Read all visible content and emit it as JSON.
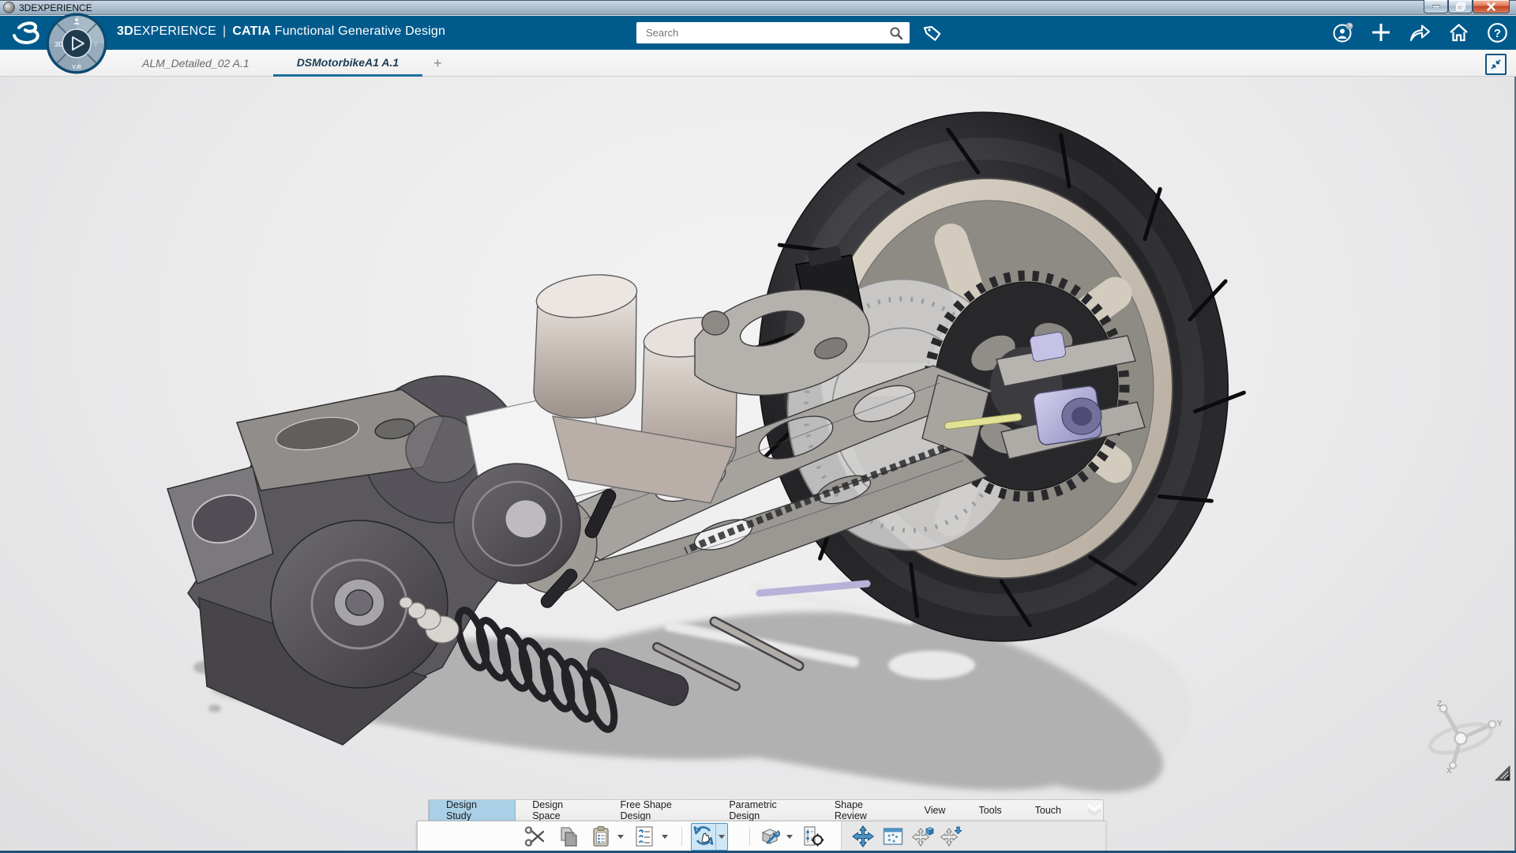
{
  "window": {
    "title": "3DEXPERIENCE",
    "controls": [
      "minimize",
      "restore",
      "close"
    ]
  },
  "appbar": {
    "brand_bold": "3D",
    "brand_rest": "EXPERIENCE",
    "divider": "|",
    "app_name": "CATIA",
    "app_role": "Functional Generative Design",
    "search_placeholder": "Search",
    "right_icons": [
      "user-profile",
      "add-content",
      "share",
      "home",
      "help"
    ],
    "compass": {
      "left": "3D",
      "right": "i",
      "bottom": "V.R",
      "top_icon": "user-quadrant-icon",
      "center_icon": "play-icon"
    }
  },
  "document_tabs": {
    "items": [
      {
        "label": "ALM_Detailed_02 A.1",
        "active": false
      },
      {
        "label": "DSMotorbikeA1 A.1",
        "active": true
      }
    ],
    "new_tab_label": "+"
  },
  "viewport": {
    "model": "motorbike rear assembly 3D model",
    "axis_triad": {
      "x": "X",
      "y": "Y",
      "z": "Z"
    }
  },
  "actionbar": {
    "tabs": [
      {
        "label": "Design Study",
        "active": true
      },
      {
        "label": "Design Space",
        "active": false
      },
      {
        "label": "Free Shape Design",
        "active": false
      },
      {
        "label": "Parametric Design",
        "active": false
      },
      {
        "label": "Shape Review",
        "active": false
      },
      {
        "label": "View",
        "active": false
      },
      {
        "label": "Tools",
        "active": false
      },
      {
        "label": "Touch",
        "active": false
      }
    ],
    "collapse_icon": "chevron-double-down",
    "toolbar_icons": [
      "cut",
      "copy",
      "paste",
      "specification-list",
      "manipulation",
      "component-tools",
      "positioning",
      "pan",
      "viewpoint-window",
      "rotate-cube",
      "rotate-pointer"
    ],
    "active_tool": "manipulation"
  },
  "colors": {
    "appbar_bg": "#005b8c",
    "accent_blue": "#1b6fa0",
    "active_doc_tab_underline": "#1b6fa0",
    "actionbar_active_tab_bg": "#a9d0e6",
    "tool_active_bg": "#cfe6f5",
    "tool_active_border": "#4a94c6",
    "close_button_red": "#c04527",
    "viewport_bg": "#ececed"
  }
}
